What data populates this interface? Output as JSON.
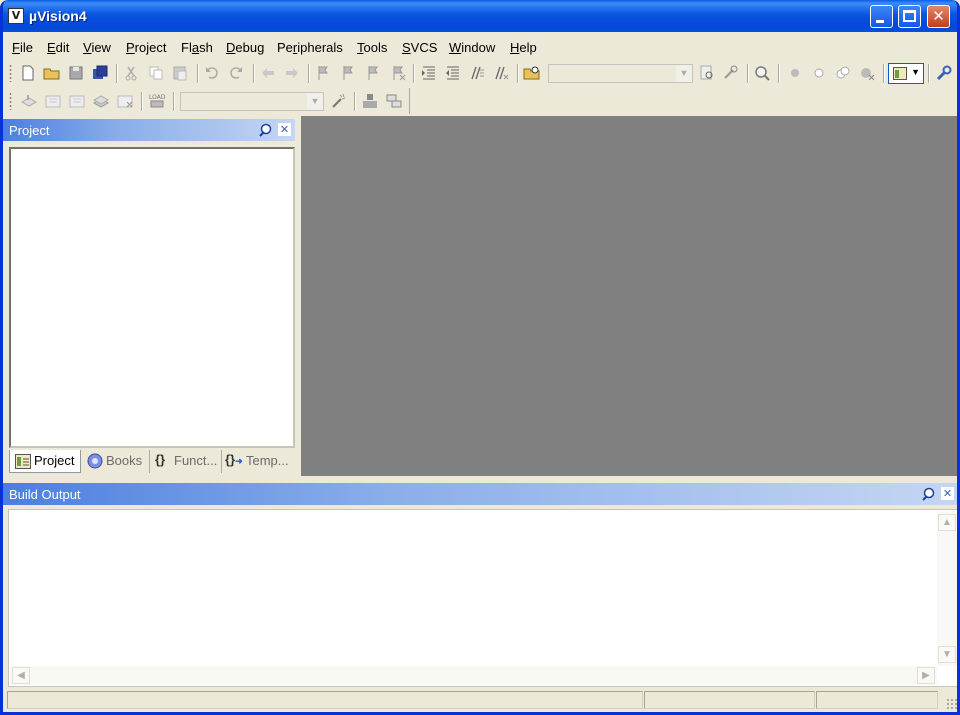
{
  "window": {
    "title": "µVision4",
    "colors": {
      "titlebar": "#0b56e0",
      "frame": "#0831d9",
      "close_button": "#c43e1b",
      "editor_bg": "#808080",
      "face": "#ece9d8"
    }
  },
  "menubar": {
    "items": [
      {
        "pre": "",
        "ul": "F",
        "post": "ile"
      },
      {
        "pre": "",
        "ul": "E",
        "post": "dit"
      },
      {
        "pre": "",
        "ul": "V",
        "post": "iew"
      },
      {
        "pre": "",
        "ul": "P",
        "post": "roject"
      },
      {
        "pre": "Fl",
        "ul": "a",
        "post": "sh"
      },
      {
        "pre": "",
        "ul": "D",
        "post": "ebug"
      },
      {
        "pre": "Pe",
        "ul": "r",
        "post": "ipherals"
      },
      {
        "pre": "",
        "ul": "T",
        "post": "ools"
      },
      {
        "pre": "",
        "ul": "S",
        "post": "VCS"
      },
      {
        "pre": "",
        "ul": "W",
        "post": "indow"
      },
      {
        "pre": "",
        "ul": "H",
        "post": "elp"
      }
    ]
  },
  "toolbar": {
    "row1_icons": [
      "new-file",
      "open-folder",
      "save",
      "save-all",
      "cut",
      "copy",
      "paste",
      "undo",
      "redo",
      "navigate-back",
      "navigate-forward",
      "bookmark-set",
      "bookmark-prev",
      "bookmark-next",
      "bookmark-clear",
      "indent",
      "unindent",
      "comment",
      "uncomment",
      "find-in-files",
      "find",
      "incremental-find",
      "search",
      "start-debug",
      "breakpoint-insert",
      "breakpoint-enable",
      "breakpoint-disable-all",
      "breakpoint-kill-all",
      "window-layout",
      "configure"
    ],
    "find_combo_value": "",
    "row2_icons": [
      "translate",
      "build",
      "rebuild",
      "batch-build",
      "stop-build",
      "download-load",
      "target-options",
      "manage-components",
      "file-extensions"
    ],
    "target_combo_value": ""
  },
  "project_panel": {
    "title": "Project",
    "tabs": [
      {
        "label": "Project",
        "icon": "project-tree-icon",
        "active": true
      },
      {
        "label": "Books",
        "icon": "books-icon",
        "active": false
      },
      {
        "label": "Funct...",
        "icon": "functions-icon",
        "active": false
      },
      {
        "label": "Temp...",
        "icon": "templates-icon",
        "active": false
      }
    ]
  },
  "output_panel": {
    "title": "Build Output",
    "content": ""
  },
  "statusbar": {
    "cells": [
      "",
      "",
      ""
    ]
  }
}
